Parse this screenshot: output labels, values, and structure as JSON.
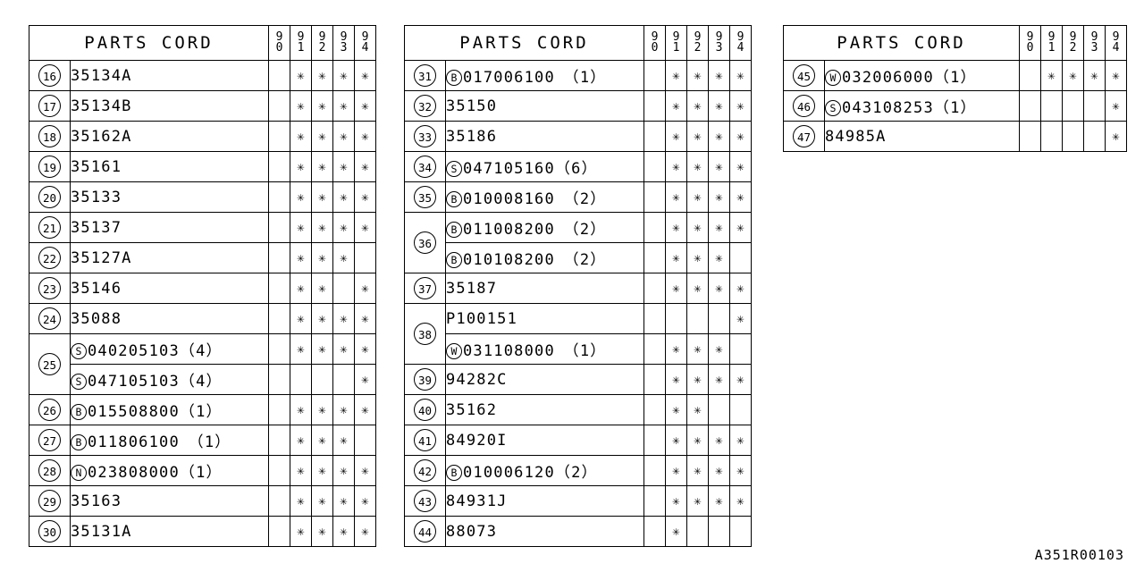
{
  "sheet": {
    "drawing_code": "A351R00103",
    "header_title": "PARTS CORD",
    "mark_glyph": "✳",
    "year_columns": [
      {
        "top": "9",
        "bottom": "0"
      },
      {
        "top": "9",
        "bottom": "1"
      },
      {
        "top": "9",
        "bottom": "2"
      },
      {
        "top": "9",
        "bottom": "3"
      },
      {
        "top": "9",
        "bottom": "4"
      }
    ]
  },
  "tables": [
    {
      "name": "left-parts-table",
      "rows": [
        {
          "ref": "16",
          "lines": [
            {
              "prefix": "",
              "code": "35134A",
              "years": [
                false,
                true,
                true,
                true,
                true
              ]
            }
          ]
        },
        {
          "ref": "17",
          "lines": [
            {
              "prefix": "",
              "code": "35134B",
              "years": [
                false,
                true,
                true,
                true,
                true
              ]
            }
          ]
        },
        {
          "ref": "18",
          "lines": [
            {
              "prefix": "",
              "code": "35162A",
              "years": [
                false,
                true,
                true,
                true,
                true
              ]
            }
          ]
        },
        {
          "ref": "19",
          "lines": [
            {
              "prefix": "",
              "code": "35161",
              "years": [
                false,
                true,
                true,
                true,
                true
              ]
            }
          ]
        },
        {
          "ref": "20",
          "lines": [
            {
              "prefix": "",
              "code": "35133",
              "years": [
                false,
                true,
                true,
                true,
                true
              ]
            }
          ]
        },
        {
          "ref": "21",
          "lines": [
            {
              "prefix": "",
              "code": "35137",
              "years": [
                false,
                true,
                true,
                true,
                true
              ]
            }
          ]
        },
        {
          "ref": "22",
          "lines": [
            {
              "prefix": "",
              "code": "35127A",
              "years": [
                false,
                true,
                true,
                true,
                false
              ]
            }
          ]
        },
        {
          "ref": "23",
          "lines": [
            {
              "prefix": "",
              "code": "35146",
              "years": [
                false,
                true,
                true,
                false,
                true
              ]
            }
          ]
        },
        {
          "ref": "24",
          "lines": [
            {
              "prefix": "",
              "code": "35088",
              "years": [
                false,
                true,
                true,
                true,
                true
              ]
            }
          ]
        },
        {
          "ref": "25",
          "lines": [
            {
              "prefix": "S",
              "code": "040205103（4）",
              "years": [
                false,
                true,
                true,
                true,
                true
              ]
            },
            {
              "prefix": "S",
              "code": "047105103（4）",
              "years": [
                false,
                false,
                false,
                false,
                true
              ]
            }
          ]
        },
        {
          "ref": "26",
          "lines": [
            {
              "prefix": "B",
              "code": "015508800（1）",
              "years": [
                false,
                true,
                true,
                true,
                true
              ]
            }
          ]
        },
        {
          "ref": "27",
          "lines": [
            {
              "prefix": "B",
              "code": "011806100　（1）",
              "years": [
                false,
                true,
                true,
                true,
                false
              ]
            }
          ]
        },
        {
          "ref": "28",
          "lines": [
            {
              "prefix": "N",
              "code": "023808000（1）",
              "years": [
                false,
                true,
                true,
                true,
                true
              ]
            }
          ]
        },
        {
          "ref": "29",
          "lines": [
            {
              "prefix": "",
              "code": "35163",
              "years": [
                false,
                true,
                true,
                true,
                true
              ]
            }
          ]
        },
        {
          "ref": "30",
          "lines": [
            {
              "prefix": "",
              "code": "35131A",
              "years": [
                false,
                true,
                true,
                true,
                true
              ]
            }
          ]
        }
      ]
    },
    {
      "name": "middle-parts-table",
      "rows": [
        {
          "ref": "31",
          "lines": [
            {
              "prefix": "B",
              "code": "017006100　（1）",
              "years": [
                false,
                true,
                true,
                true,
                true
              ]
            }
          ]
        },
        {
          "ref": "32",
          "lines": [
            {
              "prefix": "",
              "code": "35150",
              "years": [
                false,
                true,
                true,
                true,
                true
              ]
            }
          ]
        },
        {
          "ref": "33",
          "lines": [
            {
              "prefix": "",
              "code": "35186",
              "years": [
                false,
                true,
                true,
                true,
                true
              ]
            }
          ]
        },
        {
          "ref": "34",
          "lines": [
            {
              "prefix": "S",
              "code": "047105160（6）",
              "years": [
                false,
                true,
                true,
                true,
                true
              ]
            }
          ]
        },
        {
          "ref": "35",
          "lines": [
            {
              "prefix": "B",
              "code": "010008160　（2）",
              "years": [
                false,
                true,
                true,
                true,
                true
              ]
            }
          ]
        },
        {
          "ref": "36",
          "lines": [
            {
              "prefix": "B",
              "code": "011008200　（2）",
              "years": [
                false,
                true,
                true,
                true,
                true
              ]
            },
            {
              "prefix": "B",
              "code": "010108200　（2）",
              "years": [
                false,
                true,
                true,
                true,
                false
              ]
            }
          ]
        },
        {
          "ref": "37",
          "lines": [
            {
              "prefix": "",
              "code": "35187",
              "years": [
                false,
                true,
                true,
                true,
                true
              ]
            }
          ]
        },
        {
          "ref": "38",
          "lines": [
            {
              "prefix": "",
              "code": "P100151",
              "years": [
                false,
                false,
                false,
                false,
                true
              ]
            },
            {
              "prefix": "W",
              "code": "031108000　（1）",
              "years": [
                false,
                true,
                true,
                true,
                false
              ]
            }
          ]
        },
        {
          "ref": "39",
          "lines": [
            {
              "prefix": "",
              "code": "94282C",
              "years": [
                false,
                true,
                true,
                true,
                true
              ]
            }
          ]
        },
        {
          "ref": "40",
          "lines": [
            {
              "prefix": "",
              "code": "35162",
              "years": [
                false,
                true,
                true,
                false,
                false
              ]
            }
          ]
        },
        {
          "ref": "41",
          "lines": [
            {
              "prefix": "",
              "code": "84920I",
              "years": [
                false,
                true,
                true,
                true,
                true
              ]
            }
          ]
        },
        {
          "ref": "42",
          "lines": [
            {
              "prefix": "B",
              "code": "010006120（2）",
              "years": [
                false,
                true,
                true,
                true,
                true
              ]
            }
          ]
        },
        {
          "ref": "43",
          "lines": [
            {
              "prefix": "",
              "code": "84931J",
              "years": [
                false,
                true,
                true,
                true,
                true
              ]
            }
          ]
        },
        {
          "ref": "44",
          "lines": [
            {
              "prefix": "",
              "code": "88073",
              "years": [
                false,
                true,
                false,
                false,
                false
              ]
            }
          ]
        }
      ]
    },
    {
      "name": "right-parts-table",
      "rows": [
        {
          "ref": "45",
          "lines": [
            {
              "prefix": "W",
              "code": "032006000（1）",
              "years": [
                false,
                true,
                true,
                true,
                true
              ]
            }
          ]
        },
        {
          "ref": "46",
          "lines": [
            {
              "prefix": "S",
              "code": "043108253（1）",
              "years": [
                false,
                false,
                false,
                false,
                true
              ]
            }
          ]
        },
        {
          "ref": "47",
          "lines": [
            {
              "prefix": "",
              "code": "84985A",
              "years": [
                false,
                false,
                false,
                false,
                true
              ]
            }
          ]
        }
      ]
    }
  ]
}
